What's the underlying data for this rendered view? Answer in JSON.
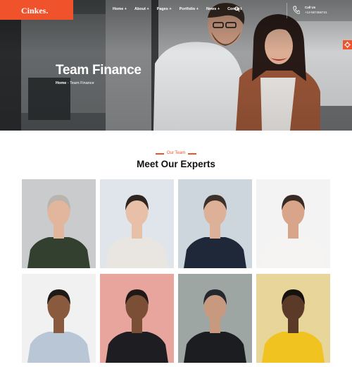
{
  "brand": {
    "logo": "Cinkes.",
    "accent_color": "#f0522c"
  },
  "nav": {
    "items": [
      "Home +",
      "About +",
      "Pages +",
      "Portfolio +",
      "News +",
      "Contact"
    ],
    "search_icon": "search-icon"
  },
  "contact": {
    "label": "Call Us",
    "phone": "+12-567456741",
    "icon": "phone-icon"
  },
  "hero": {
    "title": "Team Finance",
    "breadcrumb_home": "Home",
    "breadcrumb_separator": "-",
    "breadcrumb_current": "Team Finance"
  },
  "side_widget_icon": "gear-icon",
  "team_section": {
    "tag": "Our Team",
    "title": "Meet Our Experts",
    "members": [
      {
        "name": "member-1",
        "background": "#c9cbcc",
        "shirt": "#33402f",
        "skin": "#e2b69c",
        "hair": "#b9b4ad"
      },
      {
        "name": "member-2",
        "background": "#dfe5ea",
        "shirt": "#e9e6e2",
        "skin": "#e8c0a8",
        "hair": "#2e2420"
      },
      {
        "name": "member-3",
        "background": "#cdd6dc",
        "shirt": "#1f2838",
        "skin": "#ddb098",
        "hair": "#3b302a"
      },
      {
        "name": "member-4",
        "background": "#f3f3f3",
        "shirt": "#f6f4f2",
        "skin": "#d8a48a",
        "hair": "#3a2a24"
      },
      {
        "name": "member-5",
        "background": "#f1f1f1",
        "shirt": "#b8c6d6",
        "skin": "#8a5a3e",
        "hair": "#1e1a18"
      },
      {
        "name": "member-6",
        "background": "#e8a59d",
        "shirt": "#1e1e22",
        "skin": "#7b4e36",
        "hair": "#1f1816"
      },
      {
        "name": "member-7",
        "background": "#9ea6a4",
        "shirt": "#1b1d20",
        "skin": "#c79a80",
        "hair": "#22282d"
      },
      {
        "name": "member-8",
        "background": "#e8d59a",
        "shirt": "#f0c321",
        "skin": "#5c3a28",
        "hair": "#151210"
      }
    ]
  }
}
